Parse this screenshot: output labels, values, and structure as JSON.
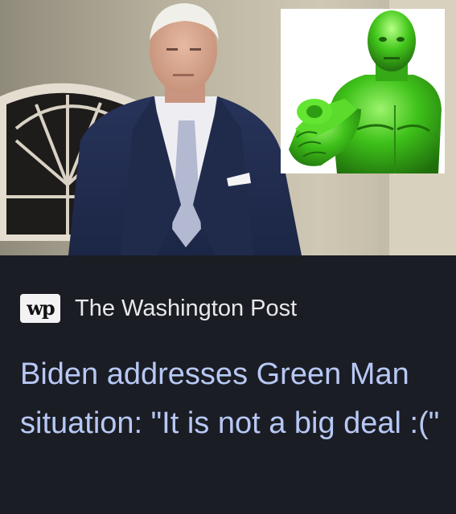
{
  "card": {
    "source": {
      "logo_text": "wp",
      "name": "The Washington Post"
    },
    "headline": "Biden addresses Green Man situation: \"It is not a big deal :(\"",
    "images": {
      "hero_photo": "biden-photo",
      "inset_photo": "green-man-pointing"
    }
  },
  "colors": {
    "card_background": "#1b1d24",
    "headline_link": "#b7c8f5",
    "source_text": "#e8e8ea",
    "green_man": "#3fc21a"
  }
}
